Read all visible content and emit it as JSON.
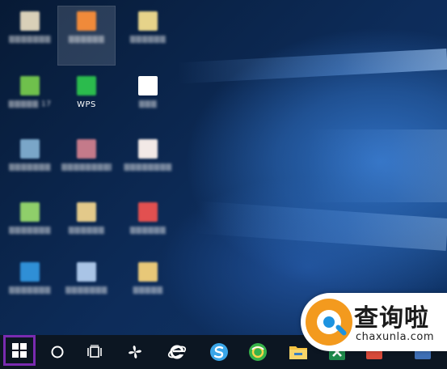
{
  "desktop": {
    "icons": [
      {
        "name": "desktop-icon-1",
        "label": "▒▒▒▒▒▒▒",
        "color": "#d9d0b8"
      },
      {
        "name": "desktop-icon-2",
        "label": "▒▒▒▒▒▒",
        "color": "#f08a3a"
      },
      {
        "name": "desktop-icon-3",
        "label": "▒▒▒▒▒▒",
        "color": "#e6d38a"
      },
      {
        "name": "desktop-icon-4",
        "label": "▒▒▒▒▒ 17",
        "color": "#6fc04c"
      },
      {
        "name": "desktop-icon-5",
        "label": "WPS",
        "color": "#2bbb4d"
      },
      {
        "name": "desktop-icon-6",
        "label": "▒▒▒",
        "color": "#ffffff"
      },
      {
        "name": "desktop-icon-7",
        "label": "▒▒▒▒▒▒▒",
        "color": "#7aa6c8"
      },
      {
        "name": "desktop-icon-8",
        "label": "▒▒▒▒▒▒▒▒▒",
        "color": "#c47a8a"
      },
      {
        "name": "desktop-icon-9",
        "label": "▒▒▒▒▒▒▒▒",
        "color": "#f2e9e6"
      },
      {
        "name": "desktop-icon-10",
        "label": "▒▒▒▒▒▒▒",
        "color": "#8fcf6a"
      },
      {
        "name": "desktop-icon-11",
        "label": "▒▒▒▒▒▒",
        "color": "#e3c98a"
      },
      {
        "name": "desktop-icon-12",
        "label": "▒▒▒▒▒▒",
        "color": "#e25050"
      },
      {
        "name": "desktop-icon-13",
        "label": "▒▒▒▒▒▒▒",
        "color": "#2f8fd6"
      },
      {
        "name": "desktop-icon-14",
        "label": "▒▒▒▒▒▒▒",
        "color": "#a9c4e6"
      },
      {
        "name": "desktop-icon-15",
        "label": "▒▒▒▒▒",
        "color": "#e8c878"
      }
    ]
  },
  "taskbar": {
    "start_icon": "windows-logo-icon",
    "items": [
      {
        "name": "cortana-search-button",
        "icon": "circle-icon"
      },
      {
        "name": "task-view-button",
        "icon": "task-view-icon"
      },
      {
        "name": "fan-app-button",
        "icon": "pinwheel-icon",
        "color": "#ffffff"
      },
      {
        "name": "internet-explorer-button",
        "icon": "ie-icon",
        "color": "#ffffff"
      },
      {
        "name": "sogou-browser-button",
        "icon": "sogou-s-icon",
        "color": "#3aa6e8"
      },
      {
        "name": "360-browser-button",
        "icon": "360-browser-icon",
        "color": "#37b34a"
      },
      {
        "name": "file-explorer-button",
        "icon": "folder-icon",
        "color": "#f5c342"
      },
      {
        "name": "excel-button",
        "icon": "excel-icon",
        "color": "#1f8a4c"
      },
      {
        "name": "app-button-9",
        "icon": "app-icon",
        "color": "#d84a3a"
      }
    ]
  },
  "watermark": {
    "title": "查询啦",
    "url": "chaxunla.com",
    "colors": {
      "orange": "#f39a1e",
      "blue": "#1d93e0"
    }
  }
}
